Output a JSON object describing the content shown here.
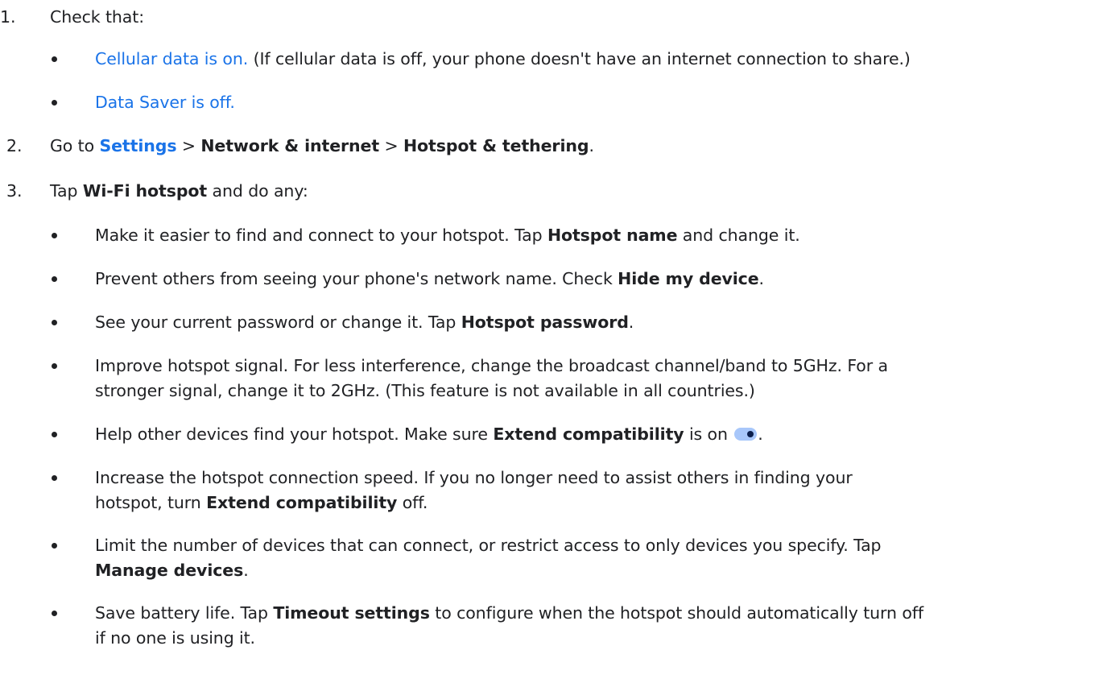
{
  "steps": [
    {
      "number": "1.",
      "text": "Check that:"
    },
    {
      "number": "2.",
      "pre": "Go to ",
      "settings_link": "Settings",
      "sep1": " > ",
      "network": "Network & internet",
      "sep2": " > ",
      "hotspot_tethering": "Hotspot & tethering",
      "end": "."
    },
    {
      "number": "3.",
      "pre": "Tap ",
      "wifi_hotspot": "Wi-Fi hotspot",
      "post": " and do any:"
    }
  ],
  "step1_bullets": [
    {
      "link": "Cellular data is on.",
      "text": " (If cellular data is off, your phone doesn't have an internet connection to share.)"
    },
    {
      "link": "Data Saver is off."
    }
  ],
  "step3_bullets": [
    {
      "pre": "Make it easier to find and connect to your hotspot. Tap ",
      "bold": "Hotspot name",
      "post": " and change it."
    },
    {
      "pre": "Prevent others from seeing your phone's network name. Check ",
      "bold": "Hide my device",
      "post": "."
    },
    {
      "pre": "See your current password or change it. Tap ",
      "bold": "Hotspot password",
      "post": "."
    },
    {
      "line1": "Improve hotspot signal. For less interference, change the broadcast channel/band to 5GHz. For a",
      "line2": "stronger signal, change it to 2GHz. (This feature is not available in all countries.)"
    },
    {
      "pre": "Help other devices find your hotspot. Make sure ",
      "bold": "Extend compatibility",
      "mid": " is on ",
      "post": ".",
      "toggle_state": "on"
    },
    {
      "line1": "Increase the hotspot connection speed. If you no longer need to assist others in finding your",
      "line2_pre": "hotspot, turn ",
      "line2_bold": "Extend compatibility",
      "line2_post": " off."
    },
    {
      "line1": "Limit the number of devices that can connect, or restrict access to only devices you specify. Tap",
      "line2_bold": "Manage devices",
      "line2_post": "."
    },
    {
      "line1_pre": "Save battery life. Tap ",
      "line1_bold": "Timeout settings",
      "line1_post": " to configure when the hotspot should automatically turn off",
      "line2": "if no one is using it."
    }
  ],
  "colors": {
    "link": "#1a73e8",
    "text": "#202124",
    "toggle_track": "#a8c7fa",
    "toggle_knob": "#0b1f4d"
  }
}
